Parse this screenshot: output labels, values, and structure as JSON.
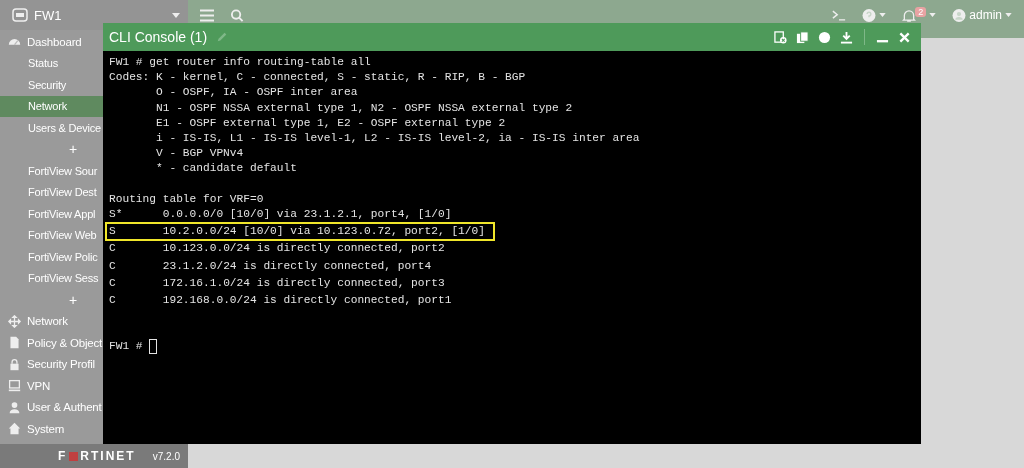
{
  "sidebar": {
    "device": "FW1",
    "items": [
      {
        "kind": "section",
        "label": "Dashboard",
        "selected": false
      },
      {
        "kind": "item",
        "label": "Status",
        "selected": false
      },
      {
        "kind": "item",
        "label": "Security",
        "selected": false
      },
      {
        "kind": "item",
        "label": "Network",
        "selected": true
      },
      {
        "kind": "item",
        "label": "Users & Device",
        "selected": false
      },
      {
        "kind": "add",
        "label": "+",
        "selected": false
      },
      {
        "kind": "item",
        "label": "FortiView Sour",
        "selected": false
      },
      {
        "kind": "item",
        "label": "FortiView Dest",
        "selected": false
      },
      {
        "kind": "item",
        "label": "FortiView Appl",
        "selected": false
      },
      {
        "kind": "item",
        "label": "FortiView Web",
        "selected": false
      },
      {
        "kind": "item",
        "label": "FortiView Polic",
        "selected": false
      },
      {
        "kind": "item",
        "label": "FortiView Sess",
        "selected": false
      },
      {
        "kind": "add",
        "label": "+",
        "selected": false
      },
      {
        "kind": "section",
        "label": "Network",
        "selected": false
      },
      {
        "kind": "section",
        "label": "Policy & Object",
        "selected": false
      },
      {
        "kind": "section",
        "label": "Security Profil",
        "selected": false
      },
      {
        "kind": "section",
        "label": "VPN",
        "selected": false
      },
      {
        "kind": "section",
        "label": "User & Authent",
        "selected": false
      },
      {
        "kind": "section",
        "label": "System",
        "selected": false
      }
    ],
    "logo": {
      "before": "F",
      "after": "RTINET"
    },
    "version": "v7.2.0"
  },
  "topbar": {
    "notification_count": "2",
    "user": "admin"
  },
  "console": {
    "title": "CLI Console (1)",
    "command_line": "FW1 # get router info routing-table all",
    "codes_label": "Codes:",
    "codes": [
      "K - kernel, C - connected, S - static, R - RIP, B - BGP",
      "O - OSPF, IA - OSPF inter area",
      "N1 - OSPF NSSA external type 1, N2 - OSPF NSSA external type 2",
      "E1 - OSPF external type 1, E2 - OSPF external type 2",
      "i - IS-IS, L1 - IS-IS level-1, L2 - IS-IS level-2, ia - IS-IS inter area",
      "V - BGP VPNv4",
      "* - candidate default"
    ],
    "routes_header": "Routing table for VRF=0",
    "routes": [
      {
        "code": "S*",
        "entry": "0.0.0.0/0 [10/0] via 23.1.2.1, port4, [1/0]",
        "highlighted": false
      },
      {
        "code": "S",
        "entry": "10.2.0.0/24 [10/0] via 10.123.0.72, port2, [1/0]",
        "highlighted": true
      },
      {
        "code": "C",
        "entry": "10.123.0.0/24 is directly connected, port2",
        "highlighted": false
      },
      {
        "code": "C",
        "entry": "23.1.2.0/24 is directly connected, port4",
        "highlighted": false
      },
      {
        "code": "C",
        "entry": "172.16.1.0/24 is directly connected, port3",
        "highlighted": false
      },
      {
        "code": "C",
        "entry": "192.168.0.0/24 is directly connected, port1",
        "highlighted": false
      }
    ],
    "prompt": "FW1 #"
  }
}
